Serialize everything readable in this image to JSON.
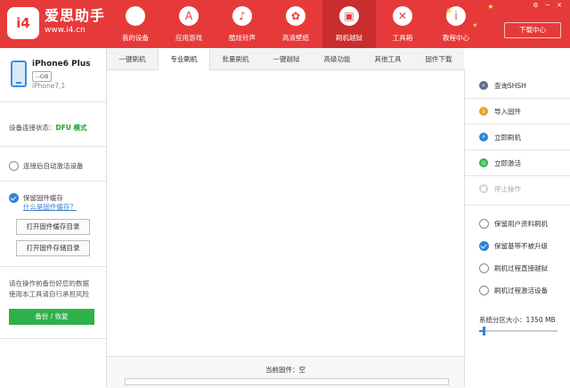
{
  "brand": {
    "logo_text": "i4",
    "title": "爱思助手",
    "url": "www.i4.cn"
  },
  "nav": [
    {
      "label": "我的设备",
      "icon": "apple-icon",
      "glyph": ""
    },
    {
      "label": "应用游戏",
      "icon": "app-store-icon",
      "glyph": "A"
    },
    {
      "label": "酷炫铃声",
      "icon": "bell-icon",
      "glyph": "♪"
    },
    {
      "label": "高清壁纸",
      "icon": "flower-icon",
      "glyph": "✿"
    },
    {
      "label": "刷机越狱",
      "icon": "box-icon",
      "glyph": "▣"
    },
    {
      "label": "工具箱",
      "icon": "tools-icon",
      "glyph": "✕"
    },
    {
      "label": "教程中心",
      "icon": "info-icon",
      "glyph": "i"
    }
  ],
  "download_center": "下载中心",
  "device": {
    "name": "iPhone6 Plus",
    "capacity": "--GB",
    "version": "iPhone7,1"
  },
  "connection": {
    "label": "设备连接状态：",
    "value": "DFU 模式"
  },
  "sidebar": {
    "auto_activate": "连接后自动激活设备",
    "keep_cache": "保留固件缓存",
    "what_is_cache": "什么是固件缓存？",
    "open_cache_dir": "打开固件缓存目录",
    "open_store_dir": "打开固件存储目录",
    "warning_line1": "请在操作前备份好您的数据",
    "warning_line2": "使用本工具请自行承担风险",
    "backup_button": "备份 / 恢复"
  },
  "tabs": [
    "一键刷机",
    "专业刷机",
    "批量刷机",
    "一键越狱",
    "高级功能",
    "其他工具",
    "固件下载"
  ],
  "active_tab": 1,
  "main": {
    "current_firmware": "当前固件：空"
  },
  "right_panel": {
    "actions": [
      {
        "label": "查询SHSH",
        "icon": "search-icon",
        "color": "#5b6f88",
        "glyph": "⌕",
        "enabled": true
      },
      {
        "label": "导入固件",
        "icon": "import-icon",
        "color": "#e6a02b",
        "glyph": "↓",
        "enabled": true
      },
      {
        "label": "立即刷机",
        "icon": "flash-icon",
        "color": "#2f82d8",
        "glyph": "⚡",
        "enabled": true
      },
      {
        "label": "立即激活",
        "icon": "globe-icon",
        "color": "#2fb14a",
        "glyph": "◎",
        "enabled": true
      },
      {
        "label": "停止操作",
        "icon": "stop-icon",
        "color": "#cfcfcf",
        "glyph": "■",
        "enabled": false
      }
    ],
    "options": [
      {
        "label": "保留用户资料刷机",
        "checked": false
      },
      {
        "label": "保留基带不被升级",
        "checked": true
      },
      {
        "label": "刷机过程直接越狱",
        "checked": false
      },
      {
        "label": "刷机过程激活设备",
        "checked": false
      }
    ],
    "partition": {
      "label": "系统分区大小：1350 MB",
      "fraction": 0.06
    }
  },
  "colors": {
    "brand_red": "#e63a3a",
    "accent_blue": "#2f82d8",
    "success_green": "#2fb14a"
  }
}
